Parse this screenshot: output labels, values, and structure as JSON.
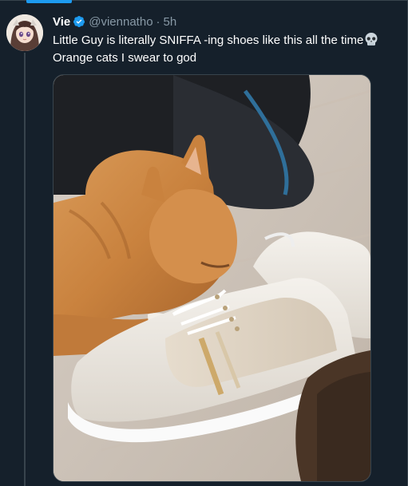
{
  "tweet": {
    "author": {
      "display_name": "Vie",
      "handle": "@viennatho",
      "verified": true,
      "avatar_icon": "avatar-anime-girl"
    },
    "separator": "·",
    "timestamp": "5h",
    "text_lines": [
      "Little Guy is literally SNIFFA -ing shoes like this all the time",
      "Orange cats I swear to god"
    ],
    "emoji": "skull-emoji",
    "media": {
      "type": "photo",
      "subject": "cat-photo"
    }
  },
  "colors": {
    "background": "#15202b",
    "border": "#38444d",
    "secondary_text": "#8899a6",
    "accent": "#1d9bf0",
    "primary_text": "#ffffff"
  }
}
